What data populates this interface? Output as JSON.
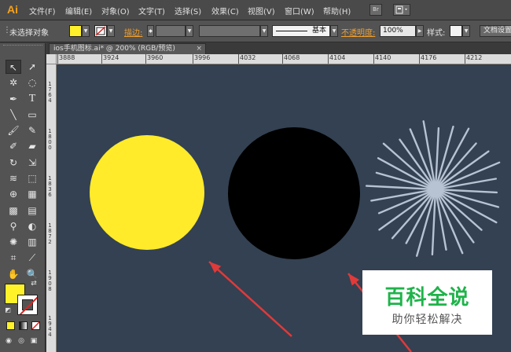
{
  "app": {
    "logo": "Ai"
  },
  "menu": {
    "items": [
      "文件(F)",
      "编辑(E)",
      "对象(O)",
      "文字(T)",
      "选择(S)",
      "效果(C)",
      "视图(V)",
      "窗口(W)",
      "帮助(H)"
    ],
    "bridge_icon": "Br"
  },
  "control_bar": {
    "selection_label": "未选择对象",
    "fill_color": "#fff12a",
    "stroke_label": "描边:",
    "stroke_profile": "基本",
    "opacity_label": "不透明度:",
    "opacity_value": "100%",
    "style_label": "样式:",
    "doc_settings_label": "文档设置"
  },
  "document_tab": {
    "title": "ios手机图标.ai* @ 200% (RGB/预览)",
    "close": "×"
  },
  "ruler": {
    "top_labels": [
      "3888",
      "3924",
      "3960",
      "3996",
      "4032",
      "4068",
      "4104",
      "4140",
      "4176",
      "4212"
    ],
    "left_labels": [
      "1764",
      "1800",
      "1836",
      "1872",
      "1908",
      "1944"
    ]
  },
  "tools": {
    "icons": [
      "selection-icon",
      "direct-selection-icon",
      "magic-wand-icon",
      "lasso-icon",
      "pen-icon",
      "type-icon",
      "line-icon",
      "rectangle-icon",
      "paintbrush-icon",
      "pencil-icon",
      "blob-brush-icon",
      "eraser-icon",
      "rotate-icon",
      "scale-icon",
      "width-icon",
      "free-transform-icon",
      "shape-builder-icon",
      "perspective-icon",
      "mesh-icon",
      "gradient-icon",
      "eyedropper-icon",
      "blend-icon",
      "symbol-sprayer-icon",
      "column-graph-icon",
      "artboard-icon",
      "slice-icon",
      "hand-icon",
      "zoom-icon"
    ],
    "fill_color": "#fff12a",
    "stroke_color": "none"
  },
  "canvas": {
    "background": "#334152",
    "yellow_circle_color": "#ffeb2a",
    "black_circle_color": "#000000",
    "sunburst_color": "#b7c3d3",
    "arrow_color": "#e03a3a"
  },
  "watermark": {
    "title": "百科全说",
    "subtitle": "助你轻松解决"
  }
}
